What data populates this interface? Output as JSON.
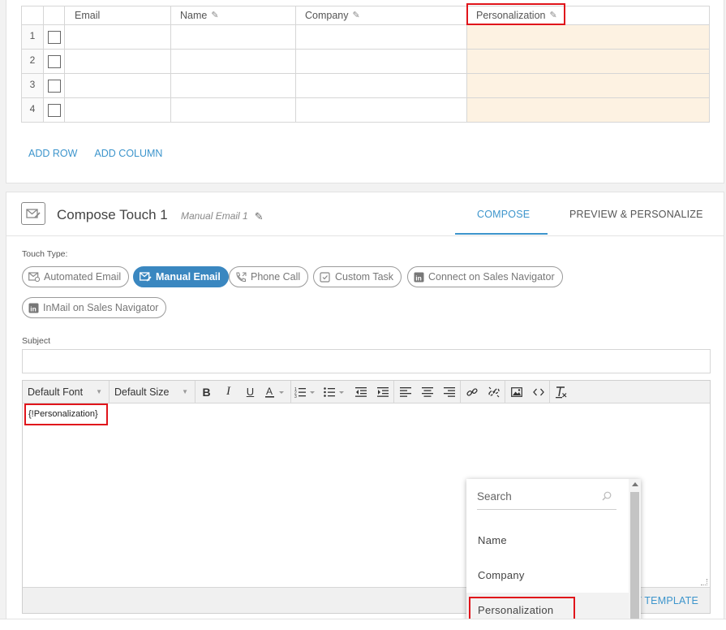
{
  "table": {
    "headers": {
      "email": "Email",
      "name": "Name",
      "company": "Company",
      "personalization": "Personalization"
    },
    "rows": [
      "1",
      "2",
      "3",
      "4"
    ],
    "add_row": "ADD ROW",
    "add_column": "ADD COLUMN"
  },
  "compose": {
    "title": "Compose Touch 1",
    "subtitle": "Manual Email 1",
    "tabs": {
      "compose": "COMPOSE",
      "preview": "PREVIEW & PERSONALIZE"
    },
    "touch_type_label": "Touch Type:",
    "touch_types": {
      "automated": "Automated Email",
      "manual": "Manual Email",
      "phone": "Phone Call",
      "custom": "Custom Task",
      "connect": "Connect on Sales Navigator",
      "inmail": "InMail on Sales Navigator"
    },
    "subject_label": "Subject",
    "subject_value": ""
  },
  "editor": {
    "font": "Default Font",
    "size": "Default Size",
    "body_token": "{!Personalization}",
    "template_link": "T TEMPLATE"
  },
  "dropdown": {
    "search_placeholder": "Search",
    "items": [
      "Name",
      "Company",
      "Personalization"
    ]
  },
  "colors": {
    "accent": "#3d95cc",
    "active_pill": "#3a87c0",
    "highlight_red": "#e0141b",
    "pers_column": "#fdf2e2"
  }
}
